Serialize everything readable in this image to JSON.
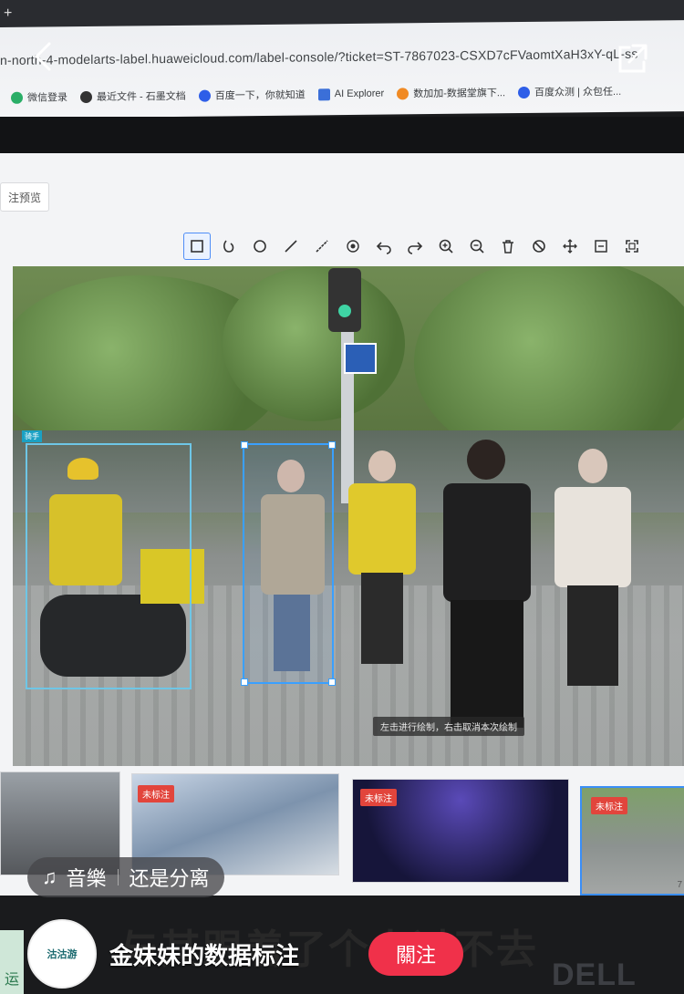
{
  "browser": {
    "new_tab": "+",
    "url": "n-north-4-modelarts-label.huaweicloud.com/label-console/?ticket=ST-7867023-CSXD7cFVaomtXaH3xY-qL-ss",
    "bookmarks": [
      {
        "label": "微信登录",
        "icon_color": "#2aae67"
      },
      {
        "label": "最近文件 - 石墨文档",
        "icon_color": "#333333"
      },
      {
        "label": "百度一下，你就知道",
        "icon_color": "#2e5ee8"
      },
      {
        "label": "AI Explorer",
        "icon_color": "#3b6fd8"
      },
      {
        "label": "数加加-数据堂旗下...",
        "icon_color": "#f08a24"
      },
      {
        "label": "百度众测 | 众包任...",
        "icon_color": "#2e5ee8"
      }
    ]
  },
  "labeling": {
    "preview_button": "注预览",
    "tools": [
      {
        "name": "rectangle-tool-icon",
        "active": true
      },
      {
        "name": "polygon-tool-icon"
      },
      {
        "name": "circle-tool-icon"
      },
      {
        "name": "line-tool-icon"
      },
      {
        "name": "dashed-line-tool-icon"
      },
      {
        "name": "point-tool-icon"
      },
      {
        "name": "undo-icon"
      },
      {
        "name": "redo-icon"
      },
      {
        "name": "zoom-in-icon"
      },
      {
        "name": "zoom-out-icon"
      },
      {
        "name": "delete-icon"
      },
      {
        "name": "hide-icon"
      },
      {
        "name": "move-icon"
      },
      {
        "name": "fit-icon"
      },
      {
        "name": "fullscreen-icon"
      }
    ],
    "box_label": "骑手",
    "hint_text": "左击进行绘制，右击取消本次绘制",
    "thumbnails": [
      {
        "tag": ""
      },
      {
        "tag": "未标注"
      },
      {
        "tag": "未标注"
      },
      {
        "tag": "未标注",
        "selected": true,
        "page": "7"
      }
    ]
  },
  "video": {
    "music_label": "音樂",
    "music_title": "还是分离",
    "caption": "与其跟着了个人过不去",
    "author_name": "金妹妹的数据标注",
    "avatar_text": "沽沽游",
    "follow_label": "關注",
    "monitor_brand": "DELL",
    "corner_text": "运"
  }
}
